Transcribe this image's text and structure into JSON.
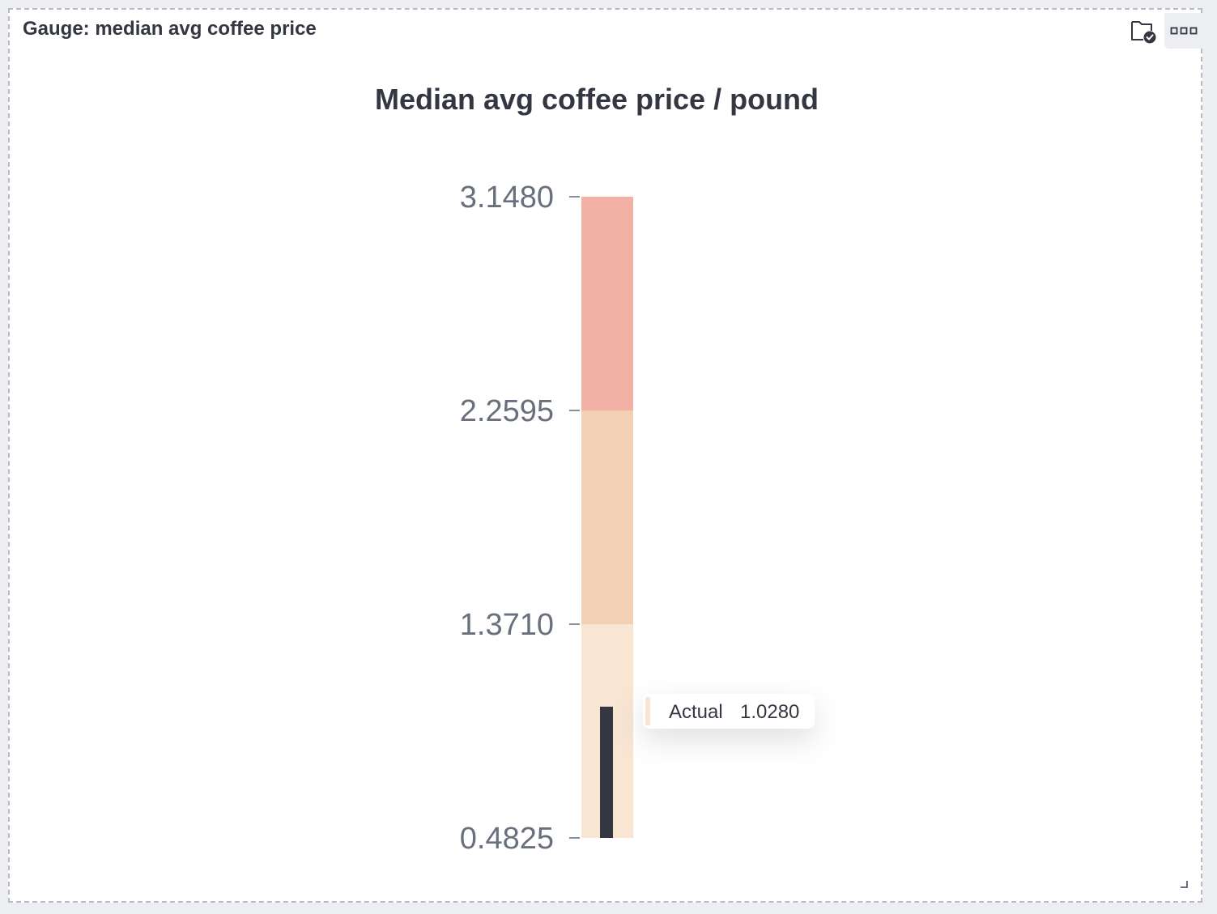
{
  "panel": {
    "title": "Gauge: median avg coffee price",
    "folder_icon": "folder-check-icon",
    "menu_icon": "ellipsis-icon",
    "resize_icon": "resize-handle-icon"
  },
  "chart_data": {
    "type": "gauge",
    "orientation": "vertical",
    "title": "Median avg coffee price / pound",
    "min": 0.4825,
    "max": 3.148,
    "ticks": [
      "0.4825",
      "1.3710",
      "2.2595",
      "3.1480"
    ],
    "tick_values": [
      0.4825,
      1.371,
      2.2595,
      3.148
    ],
    "bands": [
      {
        "from": 0.4825,
        "to": 1.371,
        "color": "#f8e5d2"
      },
      {
        "from": 1.371,
        "to": 2.2595,
        "color": "#f3cfb4"
      },
      {
        "from": 2.2595,
        "to": 3.148,
        "color": "#f3b1a6"
      }
    ],
    "actual": {
      "label": "Actual",
      "value": 1.028,
      "value_text": "1.0280",
      "color": "#343741"
    },
    "colors": {
      "title": "#343741",
      "tick_text": "#69707d",
      "tick_mark": "#8b8f99"
    }
  }
}
